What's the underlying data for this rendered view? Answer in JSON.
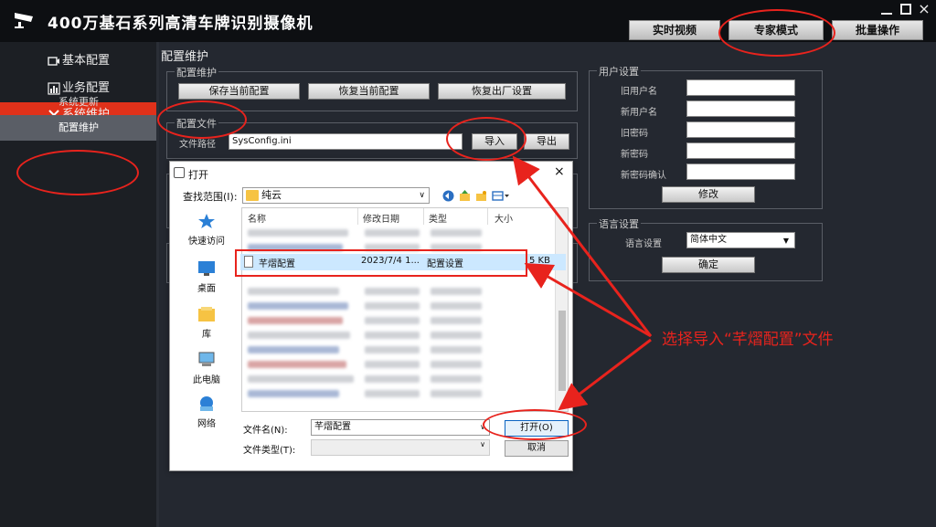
{
  "app": {
    "title": "400万基石系列高清车牌识别摄像机",
    "logo_icon": "camera-logo-icon"
  },
  "window": {
    "close_glyph": "×"
  },
  "top_tabs": [
    {
      "label": "实时视频"
    },
    {
      "label": "专家模式"
    },
    {
      "label": "批量操作"
    }
  ],
  "sidebar": {
    "items": [
      {
        "label": "基本配置",
        "icon": "video-icon"
      },
      {
        "label": "业务配置",
        "icon": "bar-chart-icon"
      },
      {
        "label": "系统维护",
        "icon": "tools-icon",
        "active": true
      }
    ],
    "subitems": [
      {
        "label": "系统更新"
      },
      {
        "label": "配置维护",
        "active": true
      }
    ]
  },
  "main": {
    "title": "配置维护",
    "maint_group": {
      "legend": "配置维护",
      "save": "保存当前配置",
      "restore": "恢复当前配置",
      "factory": "恢复出厂设置"
    },
    "file_group": {
      "legend": "配置文件",
      "path_label": "文件路径",
      "path_value": "SysConfig.ini",
      "import": "导入",
      "export": "导出"
    },
    "user_group": {
      "legend": "用户设置",
      "fields": [
        "旧用户名",
        "新用户名",
        "旧密码",
        "新密码",
        "新密码确认"
      ],
      "modify": "修改"
    },
    "lang_group": {
      "legend": "语言设置",
      "label": "语言设置",
      "value": "简体中文",
      "confirm": "确定"
    }
  },
  "dialog": {
    "title": "打开",
    "close_glyph": "×",
    "look_in_label": "查找范围(I):",
    "look_in_value": "纯云",
    "places": [
      "快速访问",
      "桌面",
      "库",
      "此电脑",
      "网络"
    ],
    "columns": [
      "名称",
      "修改日期",
      "类型",
      "大小"
    ],
    "selected_file": {
      "name": "芊熠配置",
      "date": "2023/7/4 1...",
      "type": "配置设置",
      "size": "5 KB"
    },
    "filename_label": "文件名(N):",
    "filename_value": "芊熠配置",
    "filetype_label": "文件类型(T):",
    "open_button": "打开(O)",
    "cancel_button": "取消"
  },
  "annotation": {
    "text": "选择导入“芊熠配置”文件",
    "color": "#e8231d"
  },
  "colors": {
    "accent_red": "#e0311a",
    "background": "#242830",
    "selection": "#cce8ff"
  }
}
